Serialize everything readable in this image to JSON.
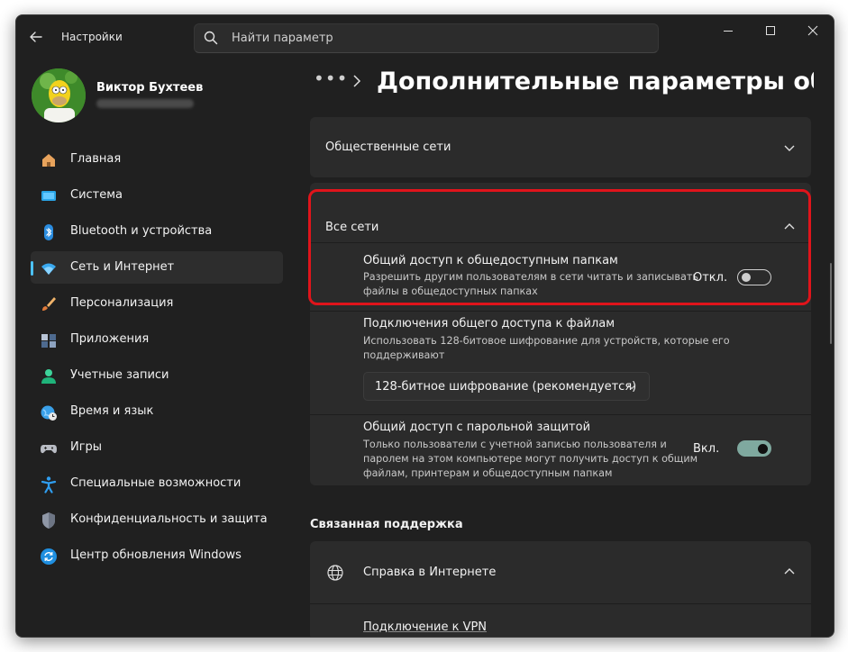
{
  "window": {
    "title": "Настройки",
    "search_placeholder": "Найти параметр"
  },
  "user": {
    "name": "Виктор Бухтеев"
  },
  "nav": {
    "items": [
      {
        "label": "Главная",
        "icon": "home-icon"
      },
      {
        "label": "Система",
        "icon": "display-icon"
      },
      {
        "label": "Bluetooth и устройства",
        "icon": "bluetooth-icon"
      },
      {
        "label": "Сеть и Интернет",
        "icon": "wifi-icon",
        "active": true
      },
      {
        "label": "Персонализация",
        "icon": "brush-icon"
      },
      {
        "label": "Приложения",
        "icon": "apps-icon"
      },
      {
        "label": "Учетные записи",
        "icon": "account-icon"
      },
      {
        "label": "Время и язык",
        "icon": "globe-clock-icon"
      },
      {
        "label": "Игры",
        "icon": "gamepad-icon"
      },
      {
        "label": "Специальные возможности",
        "icon": "accessibility-icon"
      },
      {
        "label": "Конфиденциальность и защита",
        "icon": "shield-icon"
      },
      {
        "label": "Центр обновления Windows",
        "icon": "update-icon"
      }
    ]
  },
  "header": {
    "breadcrumb_dots": "•••",
    "title": "Дополнительные параметры общего доступа"
  },
  "sections": {
    "public_networks": {
      "label": "Общественные сети"
    },
    "all_networks": {
      "label": "Все сети",
      "public_folders": {
        "title": "Общий доступ к общедоступным папкам",
        "desc_line1": "Разрешить другим пользователям в сети читать и записывать",
        "desc_line2": "файлы в общедоступных папках",
        "toggle_label": "Откл.",
        "toggle_on": false
      },
      "file_sharing": {
        "title": "Подключения общего доступа к файлам",
        "desc_line1": "Использовать 128-битовое шифрование для устройств, которые его",
        "desc_line2": "поддерживают",
        "dropdown_value": "128-битное шифрование (рекомендуется)"
      },
      "password_protected": {
        "title": "Общий доступ с парольной защитой",
        "desc_line1": "Только пользователи с учетной записью пользователя и",
        "desc_line2": "паролем на этом компьютере могут получить доступ к общим",
        "desc_line3": "файлам, принтерам и общедоступным папкам",
        "toggle_label": "Вкл.",
        "toggle_on": true
      }
    },
    "related_support": {
      "heading": "Связанная поддержка",
      "help_online": "Справка в Интернете",
      "vpn_link": "Подключение к VPN"
    }
  },
  "colors": {
    "accent": "#4cc2ff",
    "highlight": "#e0141b",
    "toggle_on": "#7fa99f",
    "background": "#202020",
    "card": "#2b2b2b"
  }
}
